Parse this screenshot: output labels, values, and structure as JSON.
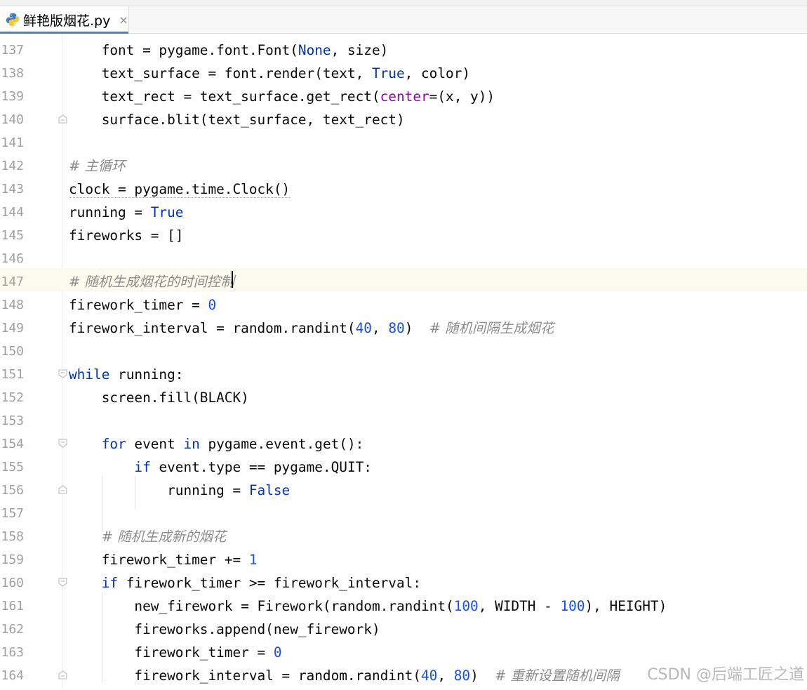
{
  "tab": {
    "label": "鲜艳版烟花.py",
    "close_glyph": "×"
  },
  "lines": [
    {
      "n": "137"
    },
    {
      "n": "138"
    },
    {
      "n": "139"
    },
    {
      "n": "140"
    },
    {
      "n": "141"
    },
    {
      "n": "142"
    },
    {
      "n": "143"
    },
    {
      "n": "144"
    },
    {
      "n": "145"
    },
    {
      "n": "146"
    },
    {
      "n": "147"
    },
    {
      "n": "148"
    },
    {
      "n": "149"
    },
    {
      "n": "150"
    },
    {
      "n": "151"
    },
    {
      "n": "152"
    },
    {
      "n": "153"
    },
    {
      "n": "154"
    },
    {
      "n": "155"
    },
    {
      "n": "156"
    },
    {
      "n": "157"
    },
    {
      "n": "158"
    },
    {
      "n": "159"
    },
    {
      "n": "160"
    },
    {
      "n": "161"
    },
    {
      "n": "162"
    },
    {
      "n": "163"
    },
    {
      "n": "164"
    }
  ],
  "code": {
    "l137": {
      "a": "    font = pygame.font.Font(",
      "b": "None",
      ",c": ", size)",
      "c": ", size)"
    },
    "l138": {
      "a": "    text_surface = font.render(text, ",
      "b": "True",
      "c": ", color)"
    },
    "l139": {
      "a": "    text_rect = text_surface.get_rect(",
      "b": "center",
      "c": "=(x, y))"
    },
    "l140": {
      "a": "    surface.blit(text_surface, text_rect)"
    },
    "l142": {
      "cmt": "# 主循环"
    },
    "l143": {
      "a": "clock = pygame.time.Clock()"
    },
    "l144": {
      "a": "running = ",
      "b": "True"
    },
    "l145": {
      "a": "fireworks = []"
    },
    "l147": {
      "cmt": "# 随机生成烟花的时间控制"
    },
    "l148": {
      "a": "firework_timer = ",
      "b": "0"
    },
    "l149": {
      "a": "firework_interval = random.randint(",
      "b": "40",
      "c": ", ",
      "d": "80",
      "e": ")  ",
      "cmt": "# 随机间隔生成烟花"
    },
    "l151": {
      "kw": "while",
      "a": " running:"
    },
    "l152": {
      "a": "    screen.fill(BLACK)"
    },
    "l154": {
      "pre": "    ",
      "kw": "for",
      "a": " event ",
      "kw2": "in",
      "b": " pygame.event.get():"
    },
    "l155": {
      "pre": "        ",
      "kw": "if",
      "a": " event.type == pygame.QUIT:"
    },
    "l156": {
      "a": "            running = ",
      "b": "False"
    },
    "l158": {
      "pre": "    ",
      "cmt": "# 随机生成新的烟花"
    },
    "l159": {
      "a": "    firework_timer += ",
      "b": "1"
    },
    "l160": {
      "pre": "    ",
      "kw": "if",
      "a": " firework_timer >= firework_interval:"
    },
    "l161": {
      "a": "        new_firework = Firework(random.randint(",
      "b": "100",
      "c": ", WIDTH - ",
      "d": "100",
      "e": "), HEIGHT)"
    },
    "l162": {
      "a": "        fireworks.append(new_firework)"
    },
    "l163": {
      "a": "        firework_timer = ",
      "b": "0"
    },
    "l164": {
      "a": "        firework_interval = random.randint(",
      "b": "40",
      "c": ", ",
      "d": "80",
      "e": ")  ",
      "cmt": "# 重新设置随机间隔"
    }
  },
  "watermark": "CSDN @后端工匠之道",
  "colors": {
    "keyword": "#0033b3",
    "number": "#1750eb",
    "named_param": "#871094",
    "comment": "#8c8c8c",
    "current_line": "#fcfaed",
    "tab_underline": "#4083c9"
  }
}
